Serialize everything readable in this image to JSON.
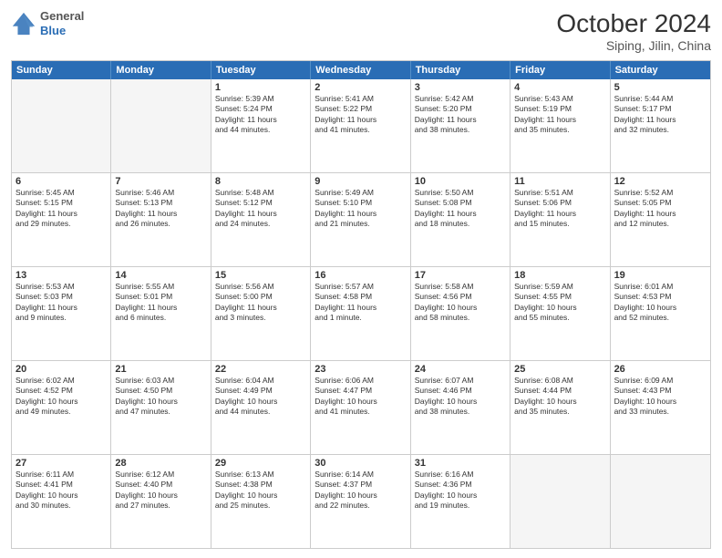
{
  "header": {
    "logo": {
      "general": "General",
      "blue": "Blue"
    },
    "title": "October 2024",
    "subtitle": "Siping, Jilin, China"
  },
  "days": [
    "Sunday",
    "Monday",
    "Tuesday",
    "Wednesday",
    "Thursday",
    "Friday",
    "Saturday"
  ],
  "rows": [
    [
      {
        "num": "",
        "empty": true
      },
      {
        "num": "",
        "empty": true
      },
      {
        "num": "1",
        "lines": [
          "Sunrise: 5:39 AM",
          "Sunset: 5:24 PM",
          "Daylight: 11 hours",
          "and 44 minutes."
        ]
      },
      {
        "num": "2",
        "lines": [
          "Sunrise: 5:41 AM",
          "Sunset: 5:22 PM",
          "Daylight: 11 hours",
          "and 41 minutes."
        ]
      },
      {
        "num": "3",
        "lines": [
          "Sunrise: 5:42 AM",
          "Sunset: 5:20 PM",
          "Daylight: 11 hours",
          "and 38 minutes."
        ]
      },
      {
        "num": "4",
        "lines": [
          "Sunrise: 5:43 AM",
          "Sunset: 5:19 PM",
          "Daylight: 11 hours",
          "and 35 minutes."
        ]
      },
      {
        "num": "5",
        "lines": [
          "Sunrise: 5:44 AM",
          "Sunset: 5:17 PM",
          "Daylight: 11 hours",
          "and 32 minutes."
        ]
      }
    ],
    [
      {
        "num": "6",
        "lines": [
          "Sunrise: 5:45 AM",
          "Sunset: 5:15 PM",
          "Daylight: 11 hours",
          "and 29 minutes."
        ]
      },
      {
        "num": "7",
        "lines": [
          "Sunrise: 5:46 AM",
          "Sunset: 5:13 PM",
          "Daylight: 11 hours",
          "and 26 minutes."
        ]
      },
      {
        "num": "8",
        "lines": [
          "Sunrise: 5:48 AM",
          "Sunset: 5:12 PM",
          "Daylight: 11 hours",
          "and 24 minutes."
        ]
      },
      {
        "num": "9",
        "lines": [
          "Sunrise: 5:49 AM",
          "Sunset: 5:10 PM",
          "Daylight: 11 hours",
          "and 21 minutes."
        ]
      },
      {
        "num": "10",
        "lines": [
          "Sunrise: 5:50 AM",
          "Sunset: 5:08 PM",
          "Daylight: 11 hours",
          "and 18 minutes."
        ]
      },
      {
        "num": "11",
        "lines": [
          "Sunrise: 5:51 AM",
          "Sunset: 5:06 PM",
          "Daylight: 11 hours",
          "and 15 minutes."
        ]
      },
      {
        "num": "12",
        "lines": [
          "Sunrise: 5:52 AM",
          "Sunset: 5:05 PM",
          "Daylight: 11 hours",
          "and 12 minutes."
        ]
      }
    ],
    [
      {
        "num": "13",
        "lines": [
          "Sunrise: 5:53 AM",
          "Sunset: 5:03 PM",
          "Daylight: 11 hours",
          "and 9 minutes."
        ]
      },
      {
        "num": "14",
        "lines": [
          "Sunrise: 5:55 AM",
          "Sunset: 5:01 PM",
          "Daylight: 11 hours",
          "and 6 minutes."
        ]
      },
      {
        "num": "15",
        "lines": [
          "Sunrise: 5:56 AM",
          "Sunset: 5:00 PM",
          "Daylight: 11 hours",
          "and 3 minutes."
        ]
      },
      {
        "num": "16",
        "lines": [
          "Sunrise: 5:57 AM",
          "Sunset: 4:58 PM",
          "Daylight: 11 hours",
          "and 1 minute."
        ]
      },
      {
        "num": "17",
        "lines": [
          "Sunrise: 5:58 AM",
          "Sunset: 4:56 PM",
          "Daylight: 10 hours",
          "and 58 minutes."
        ]
      },
      {
        "num": "18",
        "lines": [
          "Sunrise: 5:59 AM",
          "Sunset: 4:55 PM",
          "Daylight: 10 hours",
          "and 55 minutes."
        ]
      },
      {
        "num": "19",
        "lines": [
          "Sunrise: 6:01 AM",
          "Sunset: 4:53 PM",
          "Daylight: 10 hours",
          "and 52 minutes."
        ]
      }
    ],
    [
      {
        "num": "20",
        "lines": [
          "Sunrise: 6:02 AM",
          "Sunset: 4:52 PM",
          "Daylight: 10 hours",
          "and 49 minutes."
        ]
      },
      {
        "num": "21",
        "lines": [
          "Sunrise: 6:03 AM",
          "Sunset: 4:50 PM",
          "Daylight: 10 hours",
          "and 47 minutes."
        ]
      },
      {
        "num": "22",
        "lines": [
          "Sunrise: 6:04 AM",
          "Sunset: 4:49 PM",
          "Daylight: 10 hours",
          "and 44 minutes."
        ]
      },
      {
        "num": "23",
        "lines": [
          "Sunrise: 6:06 AM",
          "Sunset: 4:47 PM",
          "Daylight: 10 hours",
          "and 41 minutes."
        ]
      },
      {
        "num": "24",
        "lines": [
          "Sunrise: 6:07 AM",
          "Sunset: 4:46 PM",
          "Daylight: 10 hours",
          "and 38 minutes."
        ]
      },
      {
        "num": "25",
        "lines": [
          "Sunrise: 6:08 AM",
          "Sunset: 4:44 PM",
          "Daylight: 10 hours",
          "and 35 minutes."
        ]
      },
      {
        "num": "26",
        "lines": [
          "Sunrise: 6:09 AM",
          "Sunset: 4:43 PM",
          "Daylight: 10 hours",
          "and 33 minutes."
        ]
      }
    ],
    [
      {
        "num": "27",
        "lines": [
          "Sunrise: 6:11 AM",
          "Sunset: 4:41 PM",
          "Daylight: 10 hours",
          "and 30 minutes."
        ]
      },
      {
        "num": "28",
        "lines": [
          "Sunrise: 6:12 AM",
          "Sunset: 4:40 PM",
          "Daylight: 10 hours",
          "and 27 minutes."
        ]
      },
      {
        "num": "29",
        "lines": [
          "Sunrise: 6:13 AM",
          "Sunset: 4:38 PM",
          "Daylight: 10 hours",
          "and 25 minutes."
        ]
      },
      {
        "num": "30",
        "lines": [
          "Sunrise: 6:14 AM",
          "Sunset: 4:37 PM",
          "Daylight: 10 hours",
          "and 22 minutes."
        ]
      },
      {
        "num": "31",
        "lines": [
          "Sunrise: 6:16 AM",
          "Sunset: 4:36 PM",
          "Daylight: 10 hours",
          "and 19 minutes."
        ]
      },
      {
        "num": "",
        "empty": true
      },
      {
        "num": "",
        "empty": true
      }
    ]
  ]
}
